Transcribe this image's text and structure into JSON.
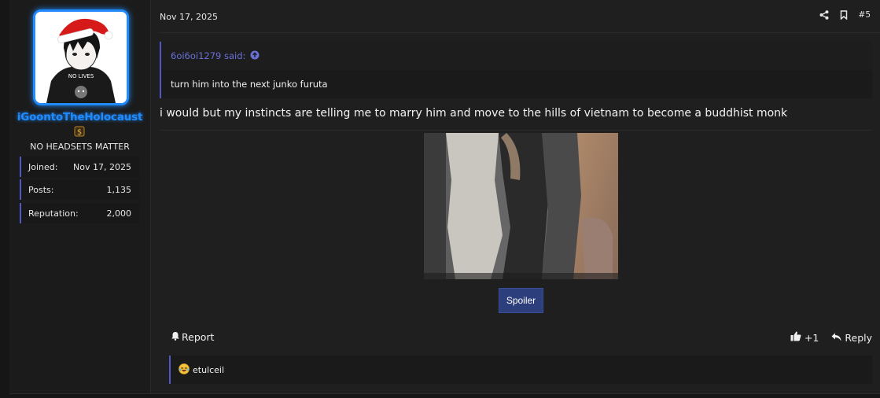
{
  "user": {
    "name": "iGoontoTheHolocaust",
    "title": "NO HEADSETS MATTER",
    "avatar_text": "NO LIVES",
    "stats": [
      {
        "label": "Joined:",
        "value": "Nov 17, 2025"
      },
      {
        "label": "Posts:",
        "value": "1,135"
      },
      {
        "label": "Reputation:",
        "value": "2,000"
      }
    ]
  },
  "post": {
    "date": "Nov 17, 2025",
    "number": "#5",
    "quote": {
      "author_line": "6oi6oi1279 said:",
      "text": "turn him into the next junko furuta"
    },
    "message": "i would but my instincts are telling me to marry him and move to the hills of vietnam to become a buddhist monk",
    "spoiler_label": "Spoiler",
    "report_label": "Report",
    "like_count": "+1",
    "reply_label": "Reply",
    "reaction_user": "etulceil"
  },
  "colors": {
    "accent": "#5257c8",
    "username": "#1f8bff",
    "spoiler": "#2c3e7c"
  }
}
